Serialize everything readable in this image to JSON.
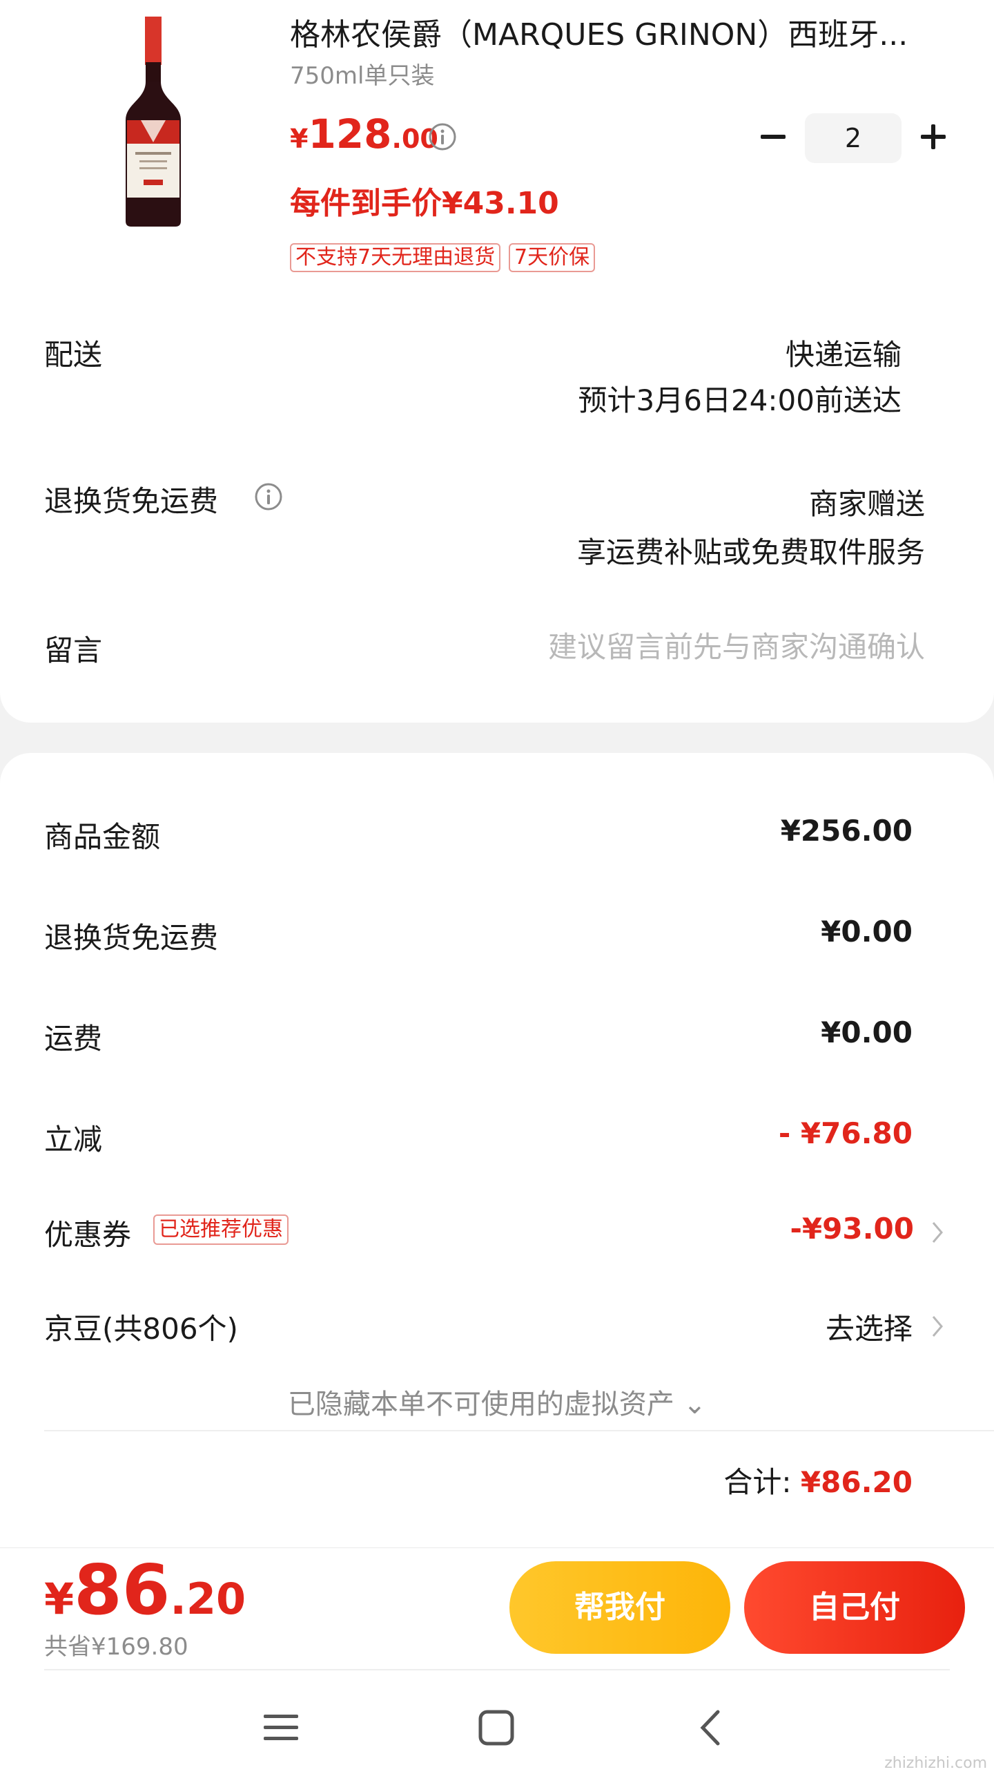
{
  "product": {
    "title": "格林农侯爵（MARQUES GRINON）西班牙...",
    "spec": "750ml单只装",
    "price_currency": "¥",
    "price_int": "128",
    "price_dec": ".00",
    "unit_price": "每件到手价¥43.10",
    "tags": [
      "不支持7天无理由退货",
      "7天价保"
    ],
    "quantity": "2"
  },
  "delivery": {
    "label": "配送",
    "method": "快递运输",
    "eta": "预计3月6日24:00前送达"
  },
  "return_shipping": {
    "label": "退换货免运费",
    "value_line1": "商家赠送",
    "value_line2": "享运费补贴或免费取件服务"
  },
  "note": {
    "label": "留言",
    "placeholder": "建议留言前先与商家沟通确认"
  },
  "summary": {
    "rows": [
      {
        "label": "商品金额",
        "amount": "¥256.00"
      },
      {
        "label": "退换货免运费",
        "amount": "¥0.00"
      },
      {
        "label": "运费",
        "amount": "¥0.00"
      },
      {
        "label": "立减",
        "amount": "- ¥76.80"
      }
    ],
    "coupon_label": "优惠券",
    "coupon_badge": "已选推荐优惠",
    "coupon_amount": "-¥93.00",
    "beans_label": "京豆(共806个)",
    "beans_value": "去选择",
    "hidden_assets": "已隐藏本单不可使用的虚拟资产 ⌄",
    "total_label": "合计:",
    "total_amount": "¥86.20"
  },
  "bottom_bar": {
    "currency": "¥",
    "total_int": "86",
    "total_dec": ".20",
    "saved": "共省¥169.80",
    "help_pay": "帮我付",
    "self_pay": "自己付"
  },
  "nav": {
    "icons": [
      "menu-icon",
      "home-icon",
      "back-icon"
    ]
  },
  "watermark": "zhizhizhi.com",
  "colors": {
    "accent_red": "#e1251b",
    "help_yellow": "#fdb509",
    "muted_gray": "#8c8c8c"
  }
}
